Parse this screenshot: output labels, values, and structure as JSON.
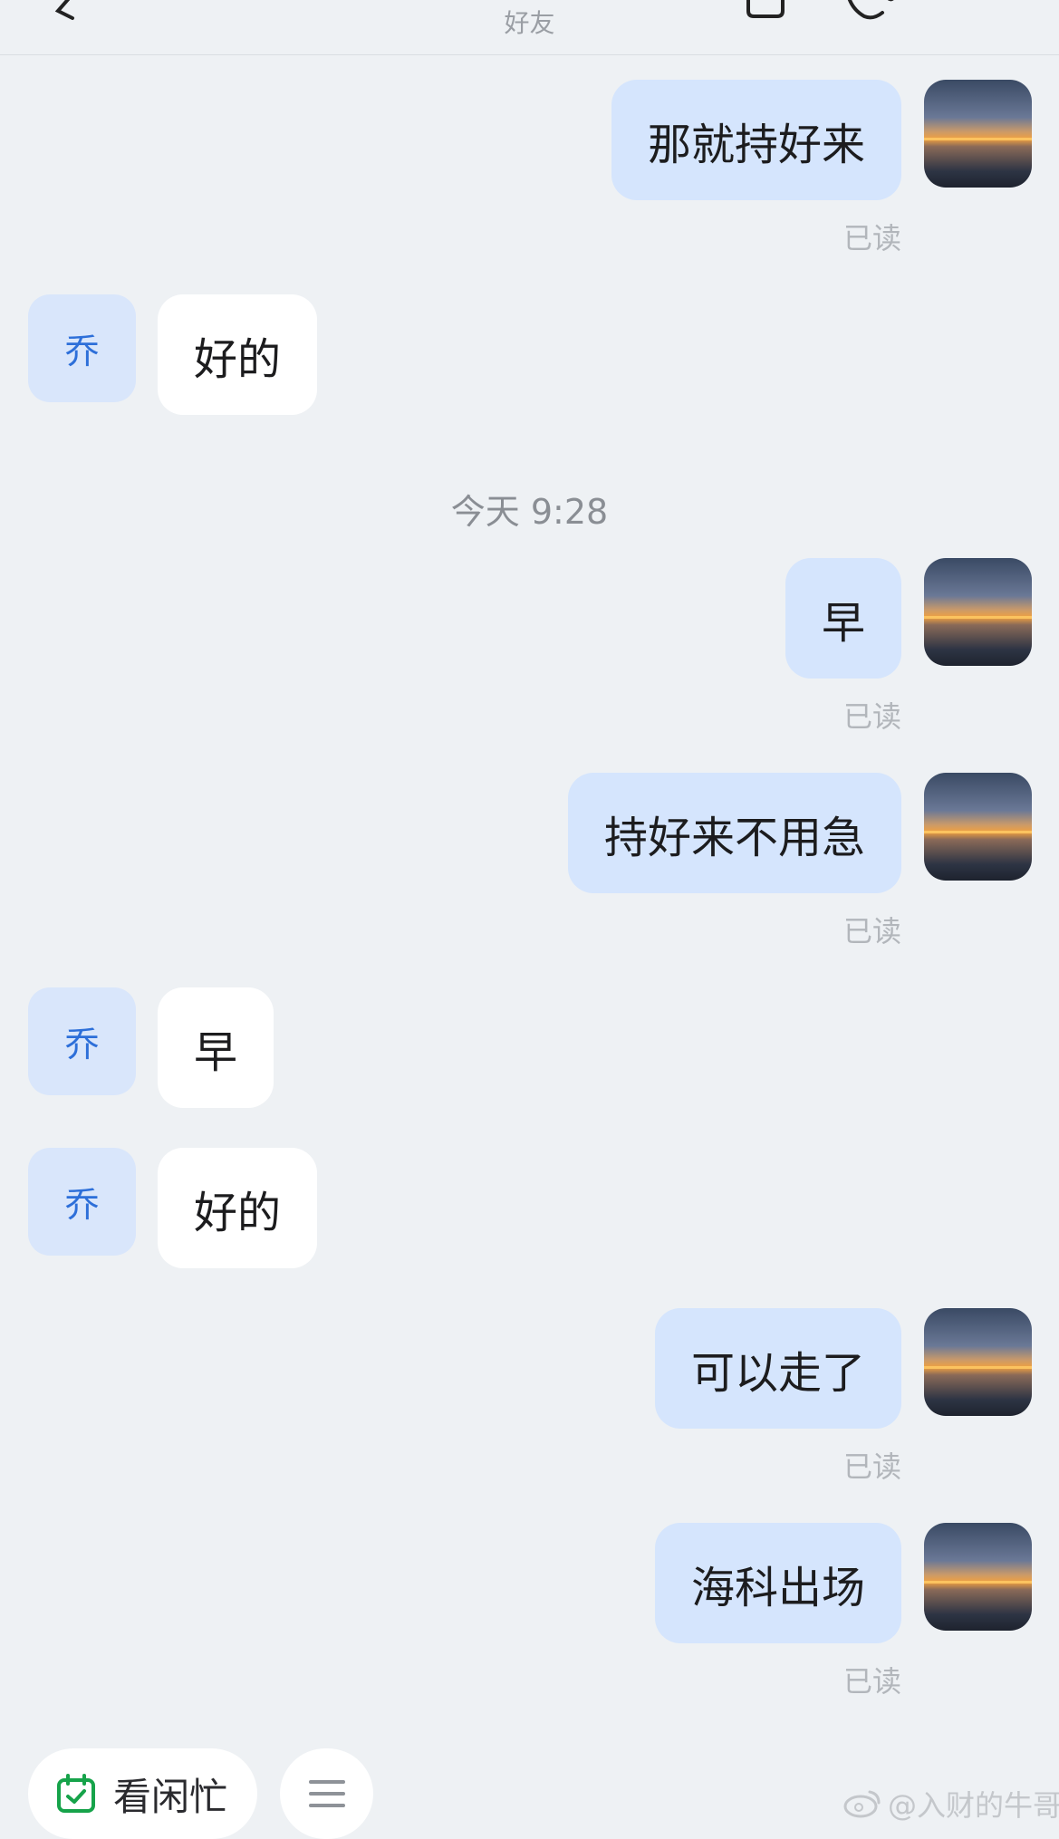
{
  "header": {
    "subtitle": "好友",
    "back_icon": "chevron-left-icon",
    "icons": [
      "phone-icon-left",
      "call-icon"
    ]
  },
  "timestamp_separator": "今天 9:28",
  "contact_avatar_text": "乔",
  "messages": [
    {
      "side": "out",
      "text": "那就持好来",
      "read": "已读"
    },
    {
      "side": "in",
      "text": "好的"
    },
    {
      "side": "out",
      "text": "早",
      "read": "已读"
    },
    {
      "side": "out",
      "text": "持好来不用急",
      "read": "已读"
    },
    {
      "side": "in",
      "text": "早"
    },
    {
      "side": "in",
      "text": "好的"
    },
    {
      "side": "out",
      "text": "可以走了",
      "read": "已读"
    },
    {
      "side": "out",
      "text": "海科出场",
      "read": "已读"
    }
  ],
  "bottom_bar": {
    "busy_label": "看闲忙",
    "busy_icon": "calendar-check-icon",
    "menu_icon": "menu-icon"
  },
  "watermark": "@入财的牛哥",
  "colors": {
    "background": "#eef1f4",
    "outgoing_bubble": "#d5e5fd",
    "incoming_bubble": "#ffffff",
    "contact_avatar_bg": "#d9e6fb",
    "contact_avatar_text": "#2d6fd9",
    "calendar_icon": "#16a34a"
  }
}
